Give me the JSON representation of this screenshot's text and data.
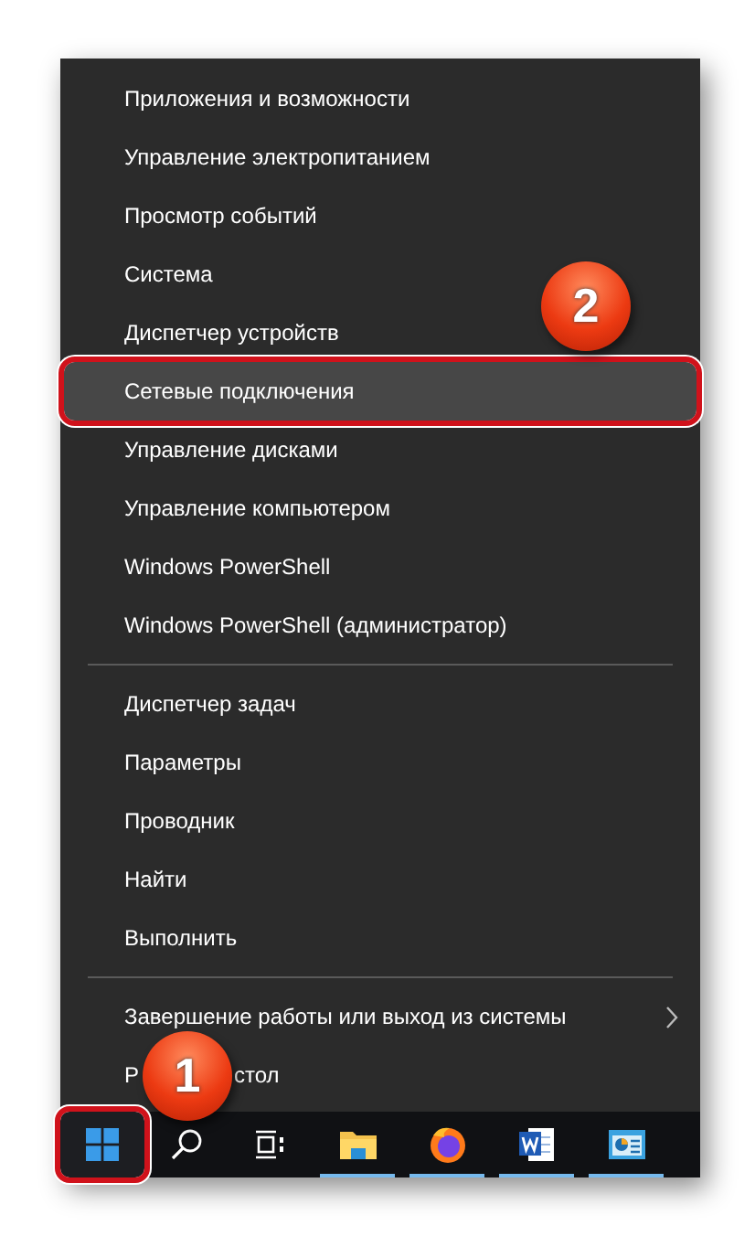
{
  "menu": {
    "groups": [
      {
        "items": [
          {
            "label": "Приложения и возможности",
            "selected": false
          },
          {
            "label": "Управление электропитанием",
            "selected": false
          },
          {
            "label": "Просмотр событий",
            "selected": false
          },
          {
            "label": "Система",
            "selected": false
          },
          {
            "label": "Диспетчер устройств",
            "selected": false
          },
          {
            "label": "Сетевые подключения",
            "selected": true
          },
          {
            "label": "Управление дисками",
            "selected": false
          },
          {
            "label": "Управление компьютером",
            "selected": false
          },
          {
            "label": "Windows PowerShell",
            "selected": false
          },
          {
            "label": "Windows PowerShell (администратор)",
            "selected": false
          }
        ]
      },
      {
        "items": [
          {
            "label": "Диспетчер задач",
            "selected": false
          },
          {
            "label": "Параметры",
            "selected": false
          },
          {
            "label": "Проводник",
            "selected": false
          },
          {
            "label": "Найти",
            "selected": false
          },
          {
            "label": "Выполнить",
            "selected": false
          }
        ]
      },
      {
        "items": [
          {
            "label": "Завершение работы или выход из системы",
            "selected": false,
            "kind": "submenu"
          },
          {
            "label_parts": [
              "Р",
              "стол"
            ],
            "selected": false,
            "kind": "item"
          }
        ]
      }
    ]
  },
  "taskbar": {
    "items": [
      {
        "kind": "start",
        "selected": true,
        "running": false
      },
      {
        "kind": "search",
        "selected": false,
        "running": false
      },
      {
        "kind": "taskview",
        "selected": false,
        "running": false
      },
      {
        "kind": "folder",
        "selected": false,
        "running": true
      },
      {
        "kind": "browser",
        "selected": false,
        "running": true
      },
      {
        "kind": "word",
        "selected": false,
        "running": true
      },
      {
        "kind": "chart",
        "selected": false,
        "running": true
      }
    ]
  },
  "callouts": [
    {
      "label": "1"
    },
    {
      "label": "2"
    }
  ]
}
